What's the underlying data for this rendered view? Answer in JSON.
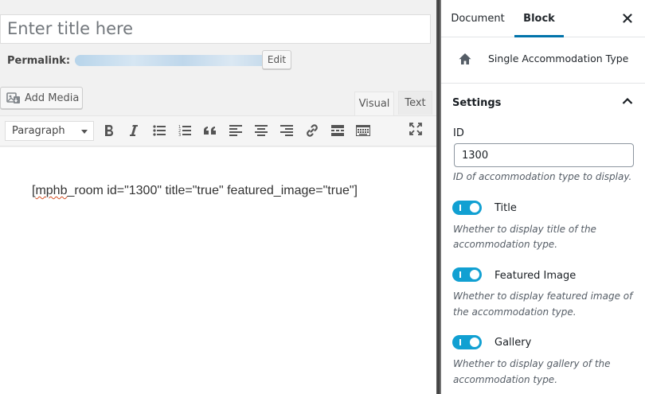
{
  "editor": {
    "title_placeholder": "Enter title here",
    "permalink_label": "Permalink:",
    "edit_button": "Edit",
    "add_media": "Add Media",
    "tabs": {
      "visual": "Visual",
      "text": "Text"
    },
    "format_select": "Paragraph",
    "toolbar_icons": [
      "bold-icon",
      "italic-icon",
      "bullet-list-icon",
      "numbered-list-icon",
      "blockquote-icon",
      "align-left-icon",
      "align-center-icon",
      "align-right-icon",
      "link-icon",
      "read-more-icon",
      "toolbar-toggle-icon",
      "fullscreen-icon"
    ],
    "content": {
      "before": "[",
      "misspelled": "mphb",
      "after": "_room id=\"1300\" title=\"true\" featured_image=\"true\"]"
    }
  },
  "sidebar": {
    "tabs": {
      "document": "Document",
      "block": "Block"
    },
    "block_name": "Single Accommodation Type",
    "settings_title": "Settings",
    "id_label": "ID",
    "id_value": "1300",
    "id_help": "ID of accommodation type to display.",
    "toggles": [
      {
        "label": "Title",
        "checked": true,
        "help": [
          "Whether to display title of the",
          "accommodation type."
        ]
      },
      {
        "label": "Featured Image",
        "checked": true,
        "help": [
          "Whether to display featured image of",
          "the accommodation type."
        ]
      },
      {
        "label": "Gallery",
        "checked": true,
        "help": [
          "Whether to display gallery of the",
          "accommodation type."
        ]
      }
    ]
  },
  "colors": {
    "accent": "#0073aa",
    "toggle_on": "#11a0d2"
  }
}
